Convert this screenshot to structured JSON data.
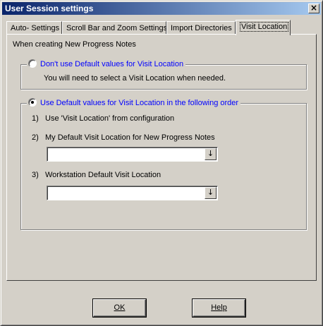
{
  "window": {
    "title": "User Session settings",
    "close_glyph": "×",
    "close_icon": "close-icon"
  },
  "tabs": [
    {
      "label": "Auto- Settings"
    },
    {
      "label": "Scroll Bar and Zoom Settings"
    },
    {
      "label": "Import Directories"
    },
    {
      "label": "Visit Location",
      "active": true
    }
  ],
  "panel": {
    "caption": "When creating New Progress Notes",
    "option_no_default": {
      "label": "Don't use Default values for Visit Location",
      "checked": false,
      "note": "You will need to select a Visit Location when needed."
    },
    "option_default": {
      "label": "Use Default values for Visit Location in the following order",
      "checked": true,
      "items": [
        {
          "num": "1)",
          "text": "Use 'Visit Location' from configuration"
        },
        {
          "num": "2)",
          "text": "My Default Visit Location  for New Progress Notes",
          "combo_value": ""
        },
        {
          "num": "3)",
          "text": "Workstation Default Visit Location",
          "combo_value": ""
        }
      ]
    }
  },
  "dropdown_glyph": "↓",
  "buttons": {
    "ok": "OK",
    "help": "Help"
  },
  "colors": {
    "title_start": "#0a246a",
    "title_end": "#a6caf0",
    "face": "#d4d0c8",
    "link_blue": "#0000ff"
  }
}
